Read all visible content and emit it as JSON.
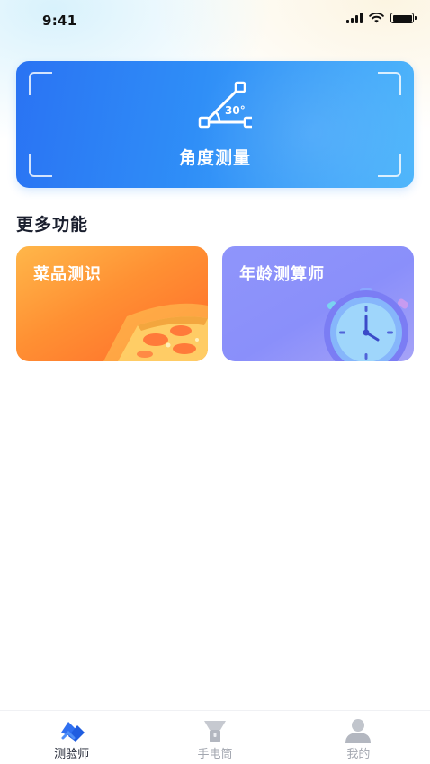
{
  "status_bar": {
    "time": "9:41"
  },
  "hero": {
    "title": "角度测量",
    "angle_value": "30°"
  },
  "section": {
    "title": "更多功能"
  },
  "features": [
    {
      "label": "菜品测识",
      "icon": "pizza-icon",
      "gradient": [
        "#ffb74a",
        "#ff6a2a"
      ]
    },
    {
      "label": "年龄测算师",
      "icon": "stopwatch-icon",
      "gradient": [
        "#8f95fb",
        "#a6a3f7"
      ]
    }
  ],
  "tabs": [
    {
      "label": "测验师",
      "icon": "measure-tool-icon",
      "active": true
    },
    {
      "label": "手电筒",
      "icon": "flashlight-icon",
      "active": false
    },
    {
      "label": "我的",
      "icon": "user-icon",
      "active": false
    }
  ],
  "colors": {
    "accent": "#2f8ef7",
    "text_primary": "#1a1f2e",
    "tab_inactive": "#a3a7b0"
  }
}
